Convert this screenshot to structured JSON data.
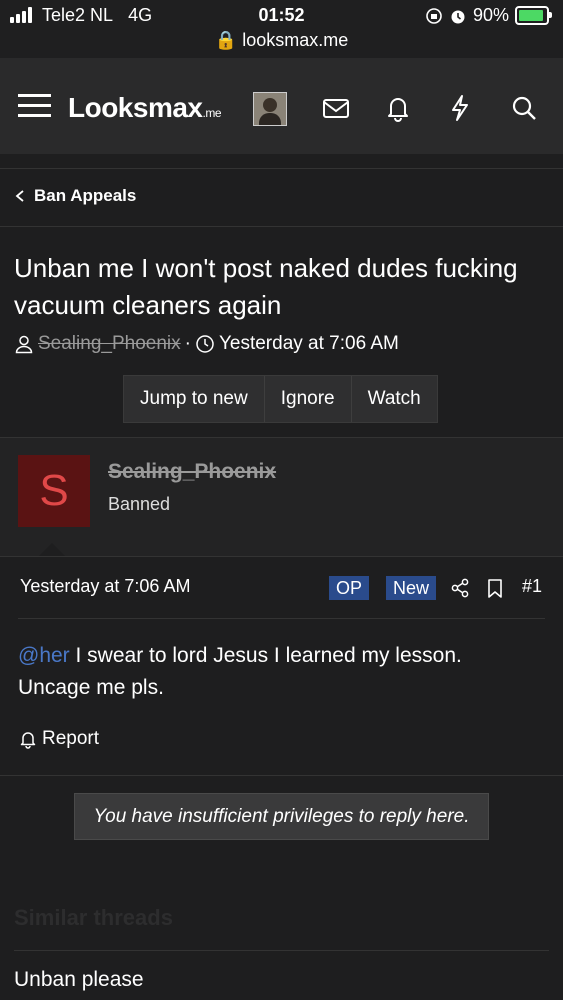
{
  "status_bar": {
    "carrier": "Tele2 NL",
    "network": "4G",
    "time": "01:52",
    "battery": "90%",
    "battery_level": 0.9,
    "url": "looksmax.me"
  },
  "header": {
    "logo_main": "Looksmax",
    "logo_suffix": ".me"
  },
  "breadcrumb": {
    "label": "Ban Appeals"
  },
  "thread": {
    "title": "Unban me I won't post naked dudes fucking vacuum cleaners again",
    "author": "Sealing_Phoenix",
    "separator": "·",
    "date": "Yesterday at 7:06 AM",
    "buttons": [
      "Jump to new",
      "Ignore",
      "Watch"
    ]
  },
  "post": {
    "avatar_letter": "S",
    "username": "Sealing_Phoenix",
    "user_status": "Banned",
    "date": "Yesterday at 7:06 AM",
    "badge_op": "OP",
    "badge_new": "New",
    "number": "#1",
    "mention": "@her",
    "body": " I swear to lord Jesus I learned my lesson. Uncage me pls.",
    "report_label": "Report"
  },
  "reply_notice": "You have insufficient privileges to reply here.",
  "similar": {
    "heading": "Similar threads",
    "items": [
      "Unban please"
    ]
  },
  "colors": {
    "background": "#1e1e1f",
    "accent_badge": "#2a4b8c",
    "mention": "#4a78c8",
    "avatar_bg": "#5a1313",
    "avatar_letter": "#e04848",
    "battery_green": "#4cd964"
  }
}
